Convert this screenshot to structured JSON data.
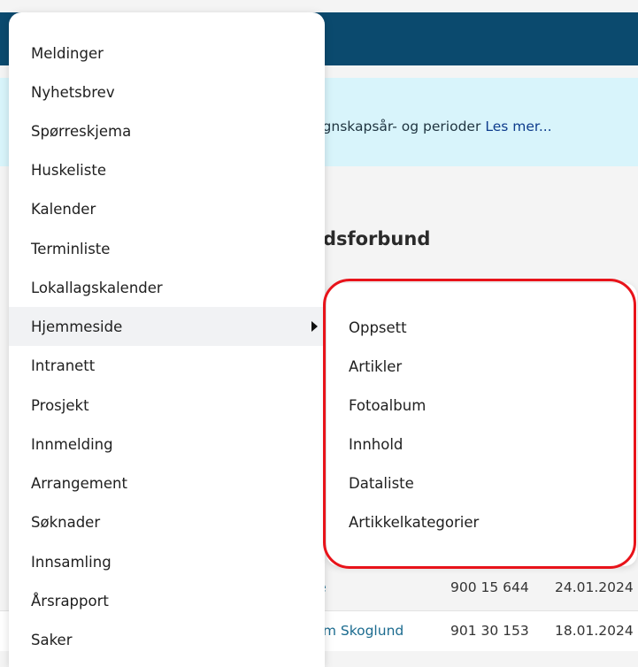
{
  "background": {
    "banner_text": "egnskapsår- og perioder",
    "banner_link": "Les mer...",
    "section_title": "ndsforbund",
    "rows": [
      {
        "name": "ie",
        "phone": "900 15 644",
        "date": "24.01.2024"
      },
      {
        "name": "um Skoglund",
        "phone": "901 30 153",
        "date": "18.01.2024"
      }
    ]
  },
  "menu": {
    "items": [
      {
        "label": "Meldinger"
      },
      {
        "label": "Nyhetsbrev"
      },
      {
        "label": "Spørreskjema"
      },
      {
        "label": "Huskeliste"
      },
      {
        "label": "Kalender"
      },
      {
        "label": "Terminliste"
      },
      {
        "label": "Lokallagskalender"
      },
      {
        "label": "Hjemmeside",
        "active": true
      },
      {
        "label": "Intranett"
      },
      {
        "label": "Prosjekt"
      },
      {
        "label": "Innmelding"
      },
      {
        "label": "Arrangement"
      },
      {
        "label": "Søknader"
      },
      {
        "label": "Innsamling"
      },
      {
        "label": "Årsrapport"
      },
      {
        "label": "Saker"
      }
    ]
  },
  "submenu": {
    "parent": "Hjemmeside",
    "items": [
      {
        "label": "Oppsett"
      },
      {
        "label": "Artikler"
      },
      {
        "label": "Fotoalbum"
      },
      {
        "label": "Innhold"
      },
      {
        "label": "Dataliste"
      },
      {
        "label": "Artikkelkategorier"
      }
    ]
  },
  "colors": {
    "header": "#0b4a6e",
    "banner": "#d8f4fb",
    "link": "#0e3c8c",
    "highlight_outline": "#e8131a"
  }
}
